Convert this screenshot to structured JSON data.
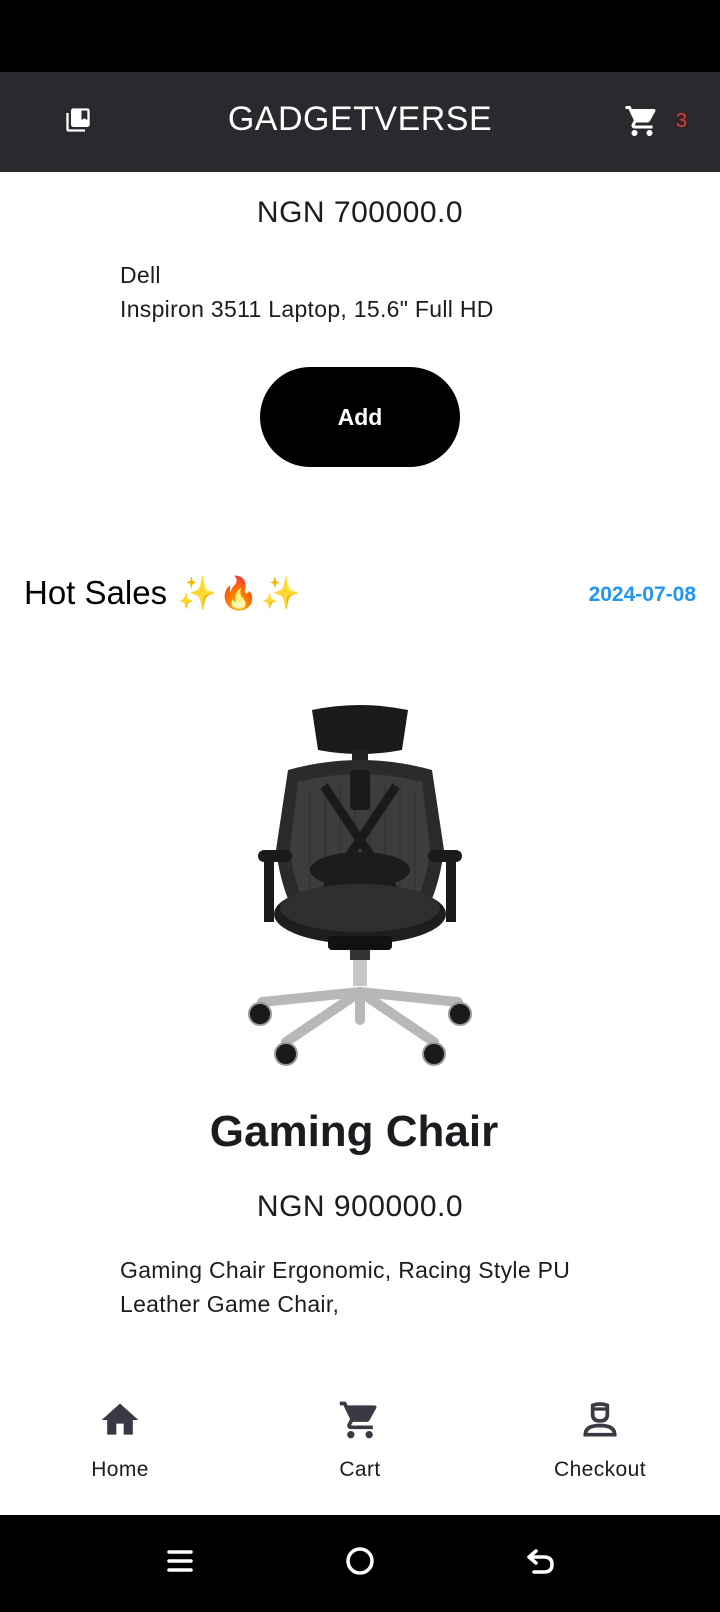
{
  "app": {
    "title": "GADGETVERSE",
    "cart_count": "3"
  },
  "top_product": {
    "price": "NGN 700000.0",
    "description_line1": "Dell",
    "description_line2": "Inspiron 3511 Laptop, 15.6\" Full HD",
    "add_label": "Add"
  },
  "hot_sales": {
    "title": "Hot Sales",
    "emoji": "✨🔥✨",
    "date": "2024-07-08"
  },
  "featured_product": {
    "name": "Gaming Chair",
    "price": "NGN 900000.0",
    "description_line1": "Gaming Chair Ergonomic, Racing Style PU",
    "description_line2": "Leather Game Chair,"
  },
  "bottom_nav": {
    "items": [
      {
        "label": "Home",
        "icon": "home-icon"
      },
      {
        "label": "Cart",
        "icon": "cart-icon"
      },
      {
        "label": "Checkout",
        "icon": "checkout-icon"
      }
    ]
  },
  "colors": {
    "app_bar": "#2b292e",
    "cart_badge": "#e53935",
    "date_accent": "#2196f3",
    "button": "#000000"
  }
}
